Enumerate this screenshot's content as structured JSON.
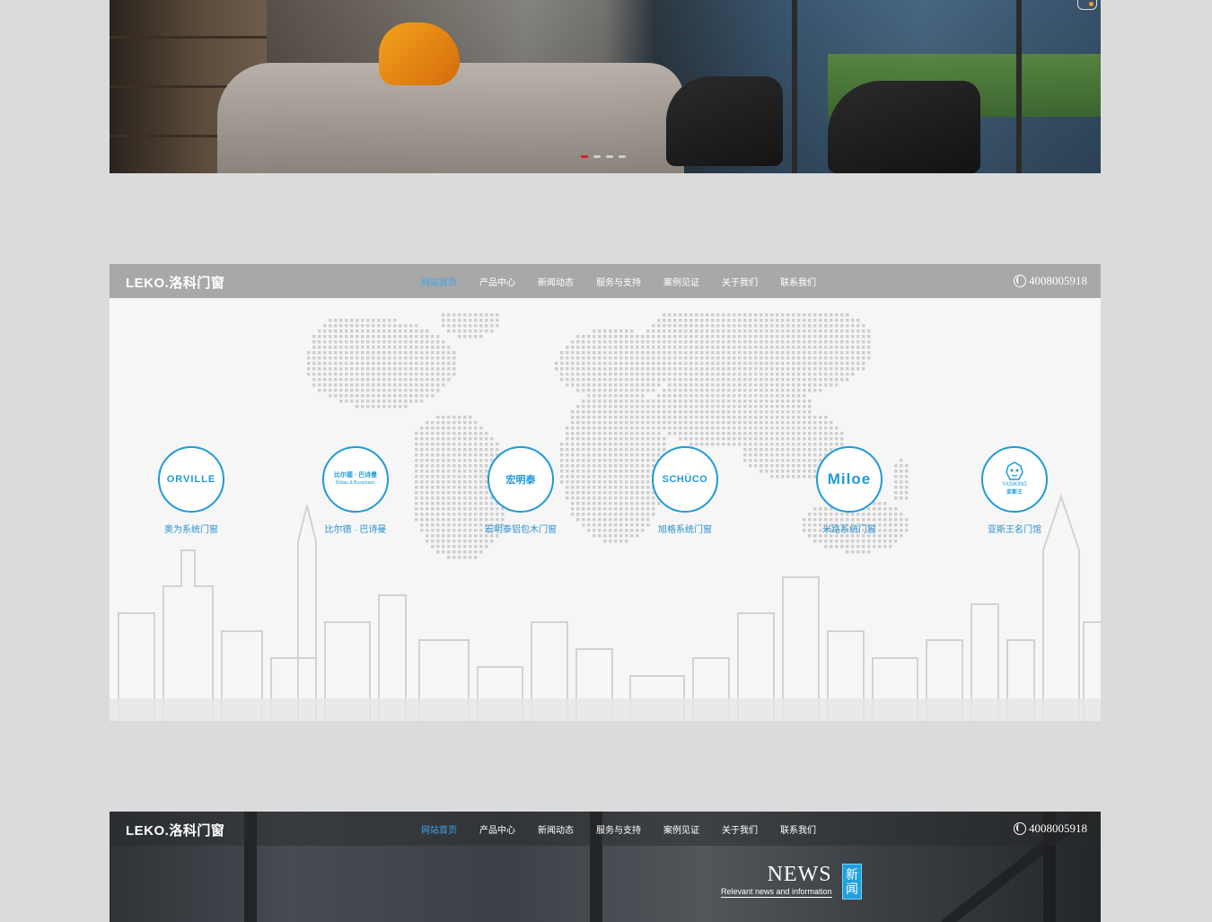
{
  "hero": {
    "slide_dots": [
      "1",
      "2",
      "3",
      "4"
    ],
    "active_dot": 0
  },
  "nav": {
    "logo": "LEKO.洛科门窗",
    "items": [
      "网站首页",
      "产品中心",
      "新闻动态",
      "服务与支持",
      "案例见证",
      "关于我们",
      "联系我们"
    ],
    "active_index": 0,
    "phone": "4008005918"
  },
  "brands": {
    "items": [
      {
        "logo_text": "ORVILLE",
        "caption": "奥为系统门窗"
      },
      {
        "logo_text": "比尔德 · 巴诗曼",
        "logo_sub": "Bildau & Bussmann",
        "caption": "比尔德 · 巴诗曼"
      },
      {
        "logo_text": "宏明泰",
        "caption": "宏明泰铝包木门窗"
      },
      {
        "logo_text": "SCHÜCO",
        "caption": "旭格系统门窗"
      },
      {
        "logo_text": "Miloe",
        "caption": "米路系统门窗"
      },
      {
        "logo_text": "YASIKING",
        "logo_sub": "亚斯王",
        "caption": "亚斯王名门馆"
      }
    ]
  },
  "news": {
    "title_en": "NEWS",
    "subtitle": "Relevant news and information",
    "badge": "新闻"
  },
  "colors": {
    "accent": "#1e9ad8",
    "active_nav": "#3fa3e8",
    "active_dot": "#d2232a",
    "page_bg": "#dcdbdc"
  }
}
